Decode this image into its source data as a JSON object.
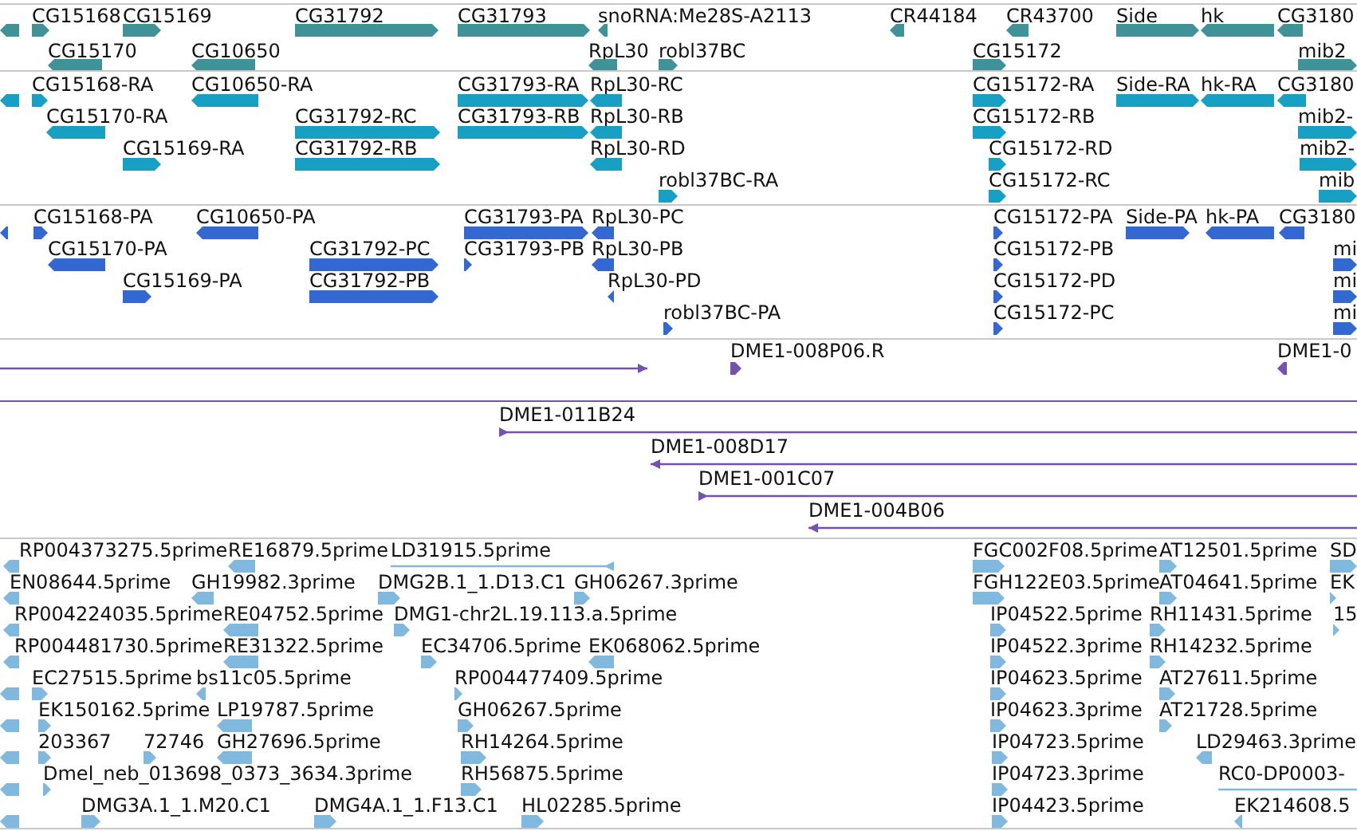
{
  "tracks": [
    {
      "kind": "gene",
      "features": [
        {
          "reverse": true
        },
        {
          "label": "CG15168",
          "reverse": false
        },
        {
          "label": "CG15169",
          "reverse": false
        },
        {
          "label": "CG31792",
          "reverse": false
        },
        {
          "label": "CG31793",
          "reverse": false
        },
        {
          "label": "snoRNA:Me28S-A2113",
          "reverse": true
        },
        {
          "label": "CR44184",
          "reverse": true
        },
        {
          "label": "CR43700",
          "reverse": true
        },
        {
          "label": "Side",
          "reverse": false
        },
        {
          "label": "hk",
          "reverse": true
        },
        {
          "label": "CG3180",
          "reverse": true
        },
        {
          "label": "CG15170",
          "reverse": true
        },
        {
          "label": "CG10650",
          "reverse": true
        },
        {
          "label": "RpL30",
          "reverse": true
        },
        {
          "label": "robl37BC",
          "reverse": false
        },
        {
          "label": "CG15172",
          "reverse": false
        },
        {
          "label": "mib2",
          "reverse": false
        }
      ]
    },
    {
      "kind": "transcript",
      "features": [
        {
          "reverse": true
        },
        {
          "label": "CG15168-RA",
          "reverse": false
        },
        {
          "label": "CG10650-RA",
          "reverse": true
        },
        {
          "label": "CG31793-RA",
          "reverse": false
        },
        {
          "label": "RpL30-RC",
          "reverse": true
        },
        {
          "label": "CG15172-RA",
          "reverse": false
        },
        {
          "label": "Side-RA",
          "reverse": false
        },
        {
          "label": "hk-RA",
          "reverse": true
        },
        {
          "label": "CG3180",
          "reverse": true
        },
        {
          "label": "CG15170-RA",
          "reverse": true
        },
        {
          "label": "CG31792-RC",
          "reverse": false
        },
        {
          "label": "CG31793-RB",
          "reverse": false
        },
        {
          "label": "RpL30-RB",
          "reverse": true
        },
        {
          "label": "CG15172-RB",
          "reverse": false
        },
        {
          "label": "mib2-",
          "reverse": false
        },
        {
          "label": "CG15169-RA",
          "reverse": false
        },
        {
          "label": "CG31792-RB",
          "reverse": false
        },
        {
          "label": "RpL30-RD",
          "reverse": true
        },
        {
          "label": "CG15172-RD",
          "reverse": false
        },
        {
          "label": "mib2-",
          "reverse": false
        },
        {
          "label": "robl37BC-RA",
          "reverse": false
        },
        {
          "label": "CG15172-RC",
          "reverse": false
        },
        {
          "label": "mib",
          "reverse": false
        }
      ]
    },
    {
      "kind": "protein",
      "features": [
        {
          "reverse": true
        },
        {
          "label": "CG15168-PA",
          "reverse": false
        },
        {
          "label": "CG10650-PA",
          "reverse": true
        },
        {
          "label": "CG31793-PA",
          "reverse": false
        },
        {
          "label": "RpL30-PC",
          "reverse": true
        },
        {
          "label": "CG15172-PA",
          "reverse": false
        },
        {
          "label": "Side-PA",
          "reverse": false
        },
        {
          "label": "hk-PA",
          "reverse": true
        },
        {
          "label": "CG3180",
          "reverse": true
        },
        {
          "label": "CG15170-PA",
          "reverse": true
        },
        {
          "label": "CG31792-PC",
          "reverse": false
        },
        {
          "label": "CG31793-PB",
          "reverse": false
        },
        {
          "label": "RpL30-PB",
          "reverse": true
        },
        {
          "label": "CG15172-PB",
          "reverse": false
        },
        {
          "label": "mi",
          "reverse": false
        },
        {
          "label": "CG15169-PA",
          "reverse": false
        },
        {
          "label": "CG31792-PB",
          "reverse": false
        },
        {
          "label": "RpL30-PD",
          "reverse": true
        },
        {
          "label": "CG15172-PD",
          "reverse": false
        },
        {
          "label": "mi",
          "reverse": false
        },
        {
          "label": "robl37BC-PA",
          "reverse": false
        },
        {
          "label": "CG15172-PC",
          "reverse": false
        },
        {
          "label": "mi",
          "reverse": false
        }
      ]
    },
    {
      "kind": "bac",
      "features": [
        {
          "reverse": false
        },
        {
          "label": "DME1-008P06.R",
          "reverse": false
        },
        {
          "label": "DME1-0",
          "reverse": true
        },
        {
          "label": "DME1-011B24",
          "reverse": false
        },
        {
          "label": "DME1-008D17",
          "reverse": true
        },
        {
          "label": "DME1-001C07",
          "reverse": false
        },
        {
          "label": "DME1-004B06",
          "reverse": true
        }
      ]
    },
    {
      "kind": "est",
      "features": [
        {
          "label": "RP004373275.5prime",
          "reverse": true
        },
        {
          "label": "RE16879.5prime",
          "reverse": true
        },
        {
          "label": "LD31915.5prime",
          "reverse": true
        },
        {
          "label": "FGC002F08.5prime",
          "reverse": false
        },
        {
          "label": "AT12501.5prime",
          "reverse": false
        },
        {
          "label": "SD",
          "reverse": false
        },
        {
          "label": "EN08644.5prime",
          "reverse": true
        },
        {
          "label": "GH19982.3prime",
          "reverse": true
        },
        {
          "label": "DMG2B.1_1.D13.C1",
          "reverse": false
        },
        {
          "label": "GH06267.3prime",
          "reverse": false
        },
        {
          "label": "FGH122E03.5prime",
          "reverse": false
        },
        {
          "label": "AT04641.5prime",
          "reverse": false
        },
        {
          "label": "EK",
          "reverse": false
        },
        {
          "label": "RP004224035.5prime",
          "reverse": true
        },
        {
          "label": "RE04752.5prime",
          "reverse": true
        },
        {
          "label": "DMG1-chr2L.19.113.a.5prime",
          "reverse": false
        },
        {
          "label": "IP04522.5prime",
          "reverse": false
        },
        {
          "label": "RH11431.5prime",
          "reverse": false
        },
        {
          "label": "15",
          "reverse": false
        },
        {
          "label": "RP004481730.5prime",
          "reverse": true
        },
        {
          "label": "RE31322.5prime",
          "reverse": true
        },
        {
          "label": "EC34706.5prime",
          "reverse": false
        },
        {
          "label": "EK068062.5prime",
          "reverse": true
        },
        {
          "label": "IP04522.3prime",
          "reverse": false
        },
        {
          "label": "RH14232.5prime",
          "reverse": false
        },
        {
          "reverse": true
        },
        {
          "label": "EC27515.5prime",
          "reverse": false
        },
        {
          "label": "bs11c05.5prime",
          "reverse": true
        },
        {
          "label": "RP004477409.5prime",
          "reverse": false
        },
        {
          "label": "IP04623.5prime",
          "reverse": false
        },
        {
          "label": "AT27611.5prime",
          "reverse": false
        },
        {
          "reverse": true
        },
        {
          "label": "EK150162.5prime",
          "reverse": false
        },
        {
          "label": "LP19787.5prime",
          "reverse": true
        },
        {
          "label": "GH06267.5prime",
          "reverse": false
        },
        {
          "label": "IP04623.3prime",
          "reverse": false
        },
        {
          "label": "AT21728.5prime",
          "reverse": false
        },
        {
          "reverse": true
        },
        {
          "label": "203367",
          "reverse": false
        },
        {
          "label": "72746",
          "reverse": false
        },
        {
          "label": "GH27696.5prime",
          "reverse": true
        },
        {
          "label": "RH14264.5prime",
          "reverse": false
        },
        {
          "label": "IP04723.5prime",
          "reverse": false
        },
        {
          "label": "LD29463.3prime",
          "reverse": true
        },
        {
          "reverse": true
        },
        {
          "label": "Dmel_neb_013698_0373_3634.3prime",
          "reverse": false
        },
        {
          "label": "RH56875.5prime",
          "reverse": false
        },
        {
          "label": "IP04723.3prime",
          "reverse": false
        },
        {
          "label": "RC0-DP0003-"
        },
        {
          "reverse": true
        },
        {
          "label": "DMG3A.1_1.M20.C1",
          "reverse": false
        },
        {
          "label": "DMG4A.1_1.F13.C1",
          "reverse": false
        },
        {
          "label": "HL02285.5prime",
          "reverse": false
        },
        {
          "label": "IP04423.5prime",
          "reverse": false
        },
        {
          "label": "EK214608.5",
          "reverse": true
        }
      ]
    }
  ]
}
